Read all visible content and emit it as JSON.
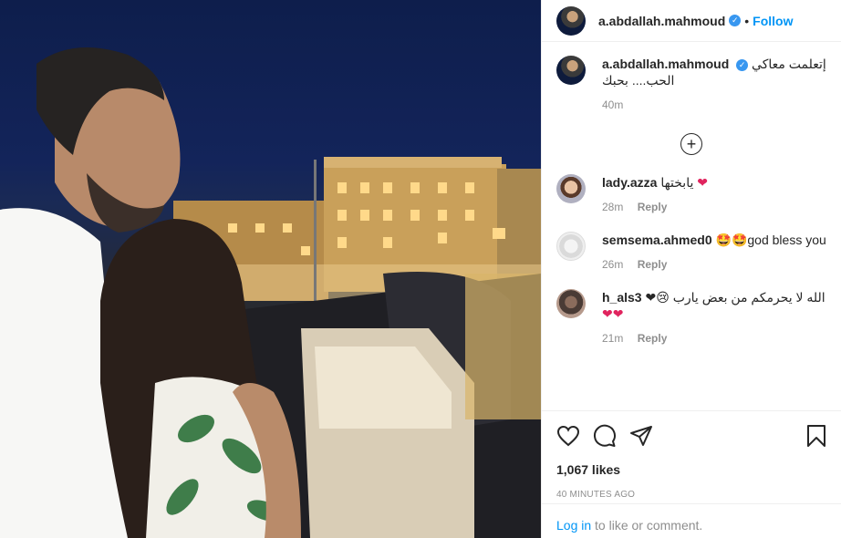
{
  "post": {
    "username": "a.abdallah.mahmoud",
    "follow_label": "Follow",
    "dot": "•",
    "verified_icon": "verified-badge-icon"
  },
  "caption": {
    "username": "a.abdallah.mahmoud",
    "text": "إتعلمت معاكي الحب.... بحبك",
    "time": "40m"
  },
  "comments": [
    {
      "username": "lady.azza",
      "text": "يابختها",
      "emoji": "❤",
      "time": "28m",
      "reply": "Reply"
    },
    {
      "username": "semsema.ahmed0",
      "text": "🤩🤩god bless you",
      "time": "26m",
      "reply": "Reply"
    },
    {
      "username": "h_als3",
      "text": "الله لا يحرمكم من بعض يارب 😢❤",
      "text2": "❤❤",
      "time": "21m",
      "reply": "Reply"
    }
  ],
  "actions": {
    "likes": "1,067 likes",
    "time": "40 MINUTES AGO"
  },
  "login": {
    "link": "Log in",
    "rest": " to like or comment."
  },
  "colors": {
    "accent": "#0095f6",
    "heart": "#e0245e",
    "muted": "#8e8e8e"
  }
}
